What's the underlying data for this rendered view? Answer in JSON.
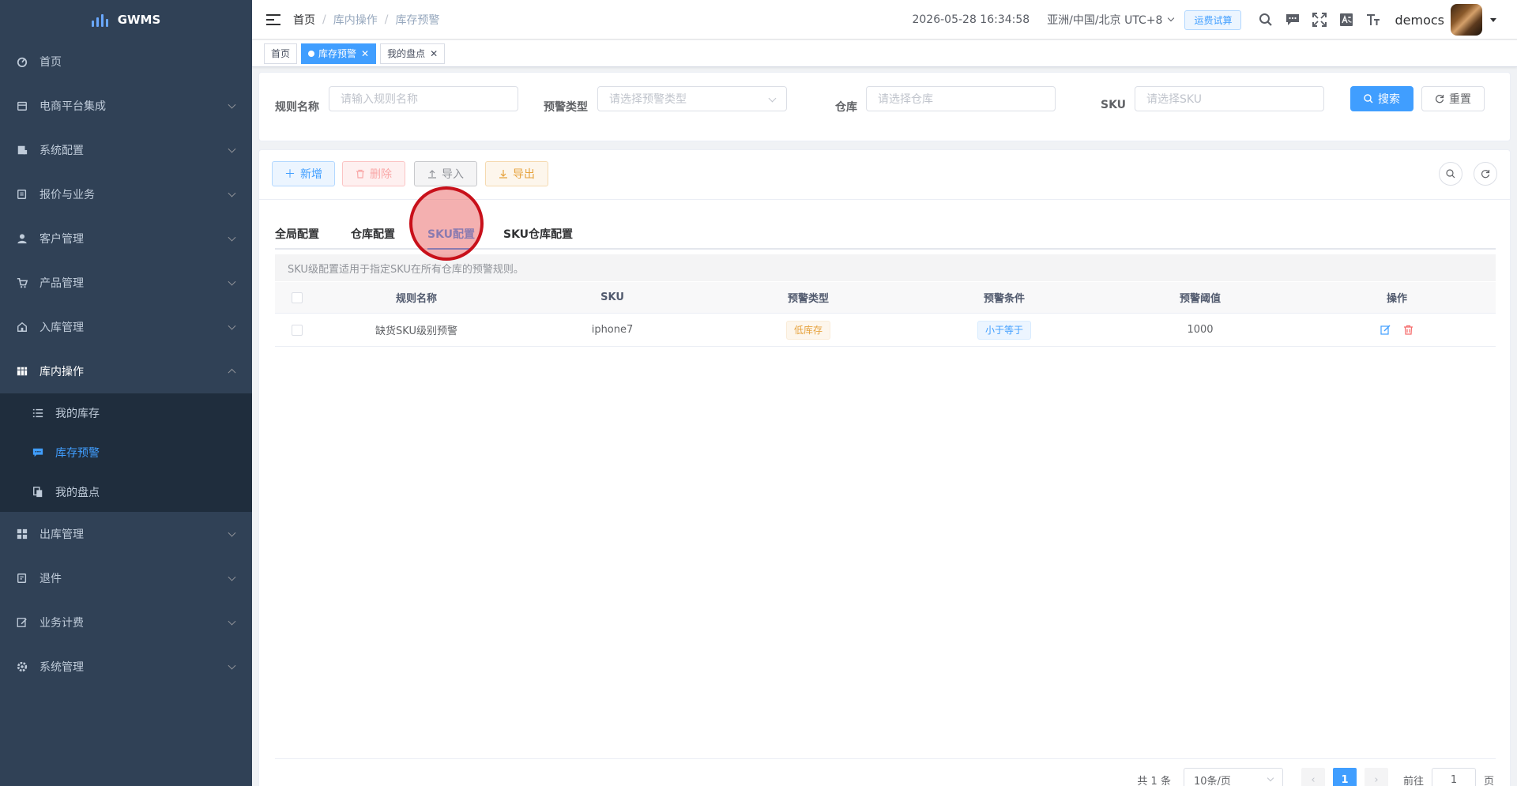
{
  "app": {
    "name": "GWMS"
  },
  "sidebar": {
    "items": [
      {
        "label": "首页",
        "icon": "dashboard-icon"
      },
      {
        "label": "电商平台集成",
        "icon": "shop-icon"
      },
      {
        "label": "系统配置",
        "icon": "config-icon"
      },
      {
        "label": "报价与业务",
        "icon": "quote-icon"
      },
      {
        "label": "客户管理",
        "icon": "user-icon"
      },
      {
        "label": "产品管理",
        "icon": "cart-icon"
      },
      {
        "label": "入库管理",
        "icon": "home-icon"
      },
      {
        "label": "库内操作",
        "icon": "grid-icon",
        "expanded": true
      },
      {
        "label": "出库管理",
        "icon": "apps-icon"
      },
      {
        "label": "退件",
        "icon": "return-icon"
      },
      {
        "label": "业务计费",
        "icon": "edit-icon"
      },
      {
        "label": "系统管理",
        "icon": "gear-icon"
      }
    ],
    "subitems": [
      {
        "label": "我的库存",
        "icon": "list-icon"
      },
      {
        "label": "库存预警",
        "icon": "message-icon",
        "active": true
      },
      {
        "label": "我的盘点",
        "icon": "copy-icon"
      }
    ]
  },
  "header": {
    "breadcrumb": [
      "首页",
      "库内操作",
      "库存预警"
    ],
    "datetime": "2026-05-28 16:34:58",
    "timezone": "亚洲/中国/北京 UTC+8",
    "fee_button": "运费试算",
    "username": "democs"
  },
  "tags": [
    {
      "label": "首页",
      "active": false,
      "closable": false
    },
    {
      "label": "库存预警",
      "active": true,
      "closable": true
    },
    {
      "label": "我的盘点",
      "active": false,
      "closable": true
    }
  ],
  "search": {
    "rule_name_label": "规则名称",
    "rule_name_placeholder": "请输入规则名称",
    "alert_type_label": "预警类型",
    "alert_type_placeholder": "请选择预警类型",
    "warehouse_label": "仓库",
    "warehouse_placeholder": "请选择仓库",
    "sku_label": "SKU",
    "sku_placeholder": "请选择SKU",
    "search_button": "搜索",
    "reset_button": "重置"
  },
  "toolbar": {
    "add": "新增",
    "delete": "删除",
    "import": "导入",
    "export": "导出"
  },
  "tabs": [
    "全局配置",
    "仓库配置",
    "SKU配置",
    "SKU仓库配置"
  ],
  "active_tab": "SKU配置",
  "alert_text": "SKU级配置适用于指定SKU在所有仓库的预警规则。",
  "table": {
    "columns": [
      "规则名称",
      "SKU",
      "预警类型",
      "预警条件",
      "预警阈值",
      "操作"
    ],
    "rows": [
      {
        "rule_name": "缺货SKU级别预警",
        "sku": "iphone7",
        "alert_type": "低库存",
        "condition": "小于等于",
        "threshold": "1000"
      }
    ]
  },
  "pagination": {
    "total_text": "共 1 条",
    "page_size": "10条/页",
    "current_page": "1",
    "goto_label": "前往",
    "goto_value": "1",
    "page_suffix": "页"
  },
  "colors": {
    "primary": "#409eff",
    "sidebar_bg": "#304156",
    "submenu_bg": "#1f2d3d",
    "click_marker": "#c8101a"
  }
}
